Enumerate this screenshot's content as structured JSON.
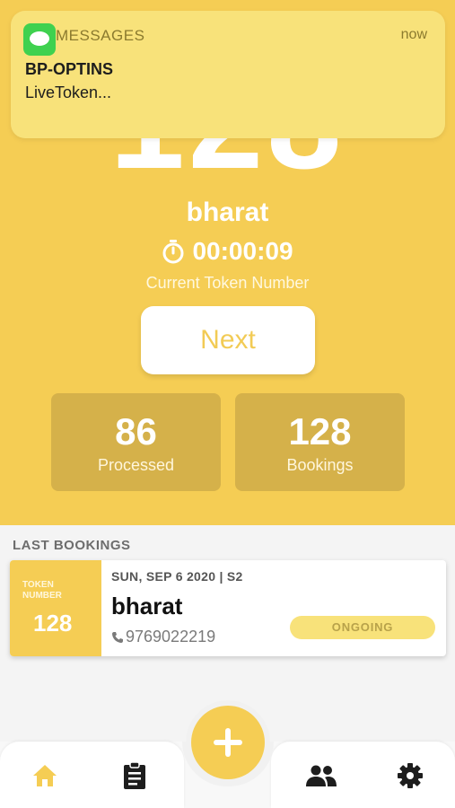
{
  "notification": {
    "app": "MESSAGES",
    "time": "now",
    "title": "BP-OPTINS",
    "body": "LiveToken..."
  },
  "current": {
    "token": "128",
    "name": "bharat",
    "timer": "00:00:09",
    "label": "Current Token Number"
  },
  "actions": {
    "next_label": "Next"
  },
  "stats": [
    {
      "value": "86",
      "label": "Processed"
    },
    {
      "value": "128",
      "label": "Bookings"
    }
  ],
  "last_bookings": {
    "title": "LAST BOOKINGS",
    "items": [
      {
        "token_label_1": "TOKEN",
        "token_label_2": "NUMBER",
        "token": "128",
        "date": "SUN, SEP 6 2020 | S2",
        "name": "bharat",
        "phone": "9769022219",
        "status": "ONGOING"
      }
    ]
  },
  "nav": {
    "items": [
      {
        "icon": "home-icon"
      },
      {
        "icon": "clipboard-icon"
      },
      {
        "icon": "people-icon"
      },
      {
        "icon": "gear-icon"
      }
    ],
    "fab_icon": "plus-icon"
  },
  "colors": {
    "primary": "#f5cd54",
    "stat_card": "#d5b14a",
    "notification_bg": "#f8e27a",
    "badge_bg": "#f8e27a"
  }
}
